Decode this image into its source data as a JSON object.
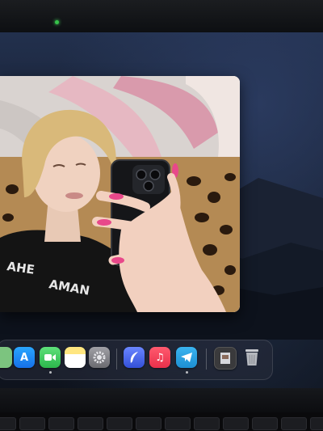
{
  "scene": {
    "description_free": true
  },
  "dock": {
    "apps": [
      {
        "name": "partial-app",
        "color": "#7cc47f"
      },
      {
        "name": "app-store",
        "color": "#1e8cf5"
      },
      {
        "name": "facetime",
        "color": "#35c759"
      },
      {
        "name": "notes",
        "color": "#f7d560"
      },
      {
        "name": "system-settings",
        "color": "#8e8e93"
      },
      {
        "name": "feather-app",
        "color": "#4a6cf0"
      },
      {
        "name": "music",
        "color": "#fa3c55"
      },
      {
        "name": "telegram",
        "color": "#2aa4e0"
      },
      {
        "name": "recent-file",
        "color": "#3a3a3c"
      },
      {
        "name": "trash",
        "color": "#9a9ca3"
      }
    ]
  }
}
